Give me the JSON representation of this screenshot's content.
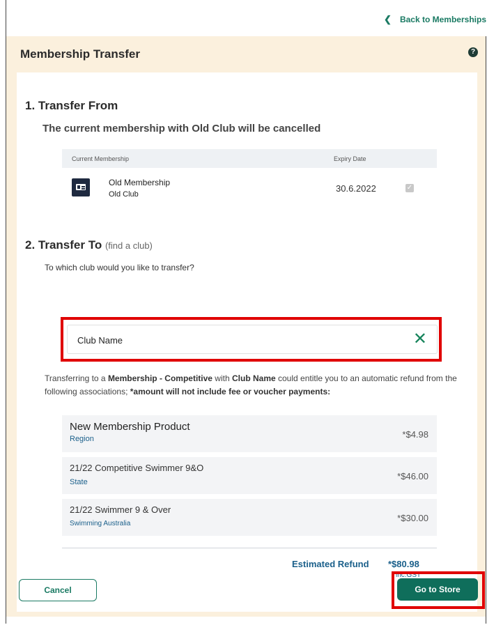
{
  "nav": {
    "back_label": "Back to Memberships",
    "back_icon": "chevron-left-icon"
  },
  "header": {
    "title": "Membership Transfer",
    "help_icon": "question-circle-icon"
  },
  "section_from": {
    "title": "1. Transfer From",
    "note": "The current membership with Old Club will be cancelled",
    "table": {
      "col_membership": "Current Membership",
      "col_expiry": "Expiry Date",
      "row": {
        "name": "Old Membership",
        "club": "Old Club",
        "expiry": "30.6.2022",
        "checked": true
      }
    }
  },
  "section_to": {
    "title": "2. Transfer To",
    "find_link": "(find a club)",
    "question": "To which club would you like to transfer?",
    "club_input_value": "Club Name",
    "clear_icon": "close-x-icon",
    "explain_prefix": "Transferring to a ",
    "explain_product": "Membership - Competitive",
    "explain_with": " with ",
    "explain_club": "Club Name",
    "explain_mid": " could entitle you to an automatic refund from the following associations; ",
    "explain_bold_tail": "*amount will not include fee or voucher payments:"
  },
  "refunds": [
    {
      "name": "New Membership Product",
      "org": "Region",
      "amount": "*$4.98"
    },
    {
      "name": "21/22 Competitive Swimmer 9&O",
      "org": "State",
      "amount": "*$46.00"
    },
    {
      "name": "21/22 Swimmer 9 & Over",
      "org": "Swimming Australia",
      "amount": "*$30.00"
    }
  ],
  "estimate": {
    "label": "Estimated Refund",
    "amount": "*$80.98",
    "note": "inc.GST"
  },
  "buttons": {
    "cancel": "Cancel",
    "go_to_store": "Go to Store"
  },
  "colors": {
    "accent": "#0f6e5b",
    "highlight_box": "#e00000",
    "card_bg": "#fbf0dd",
    "link_blue": "#1a5f8a"
  }
}
